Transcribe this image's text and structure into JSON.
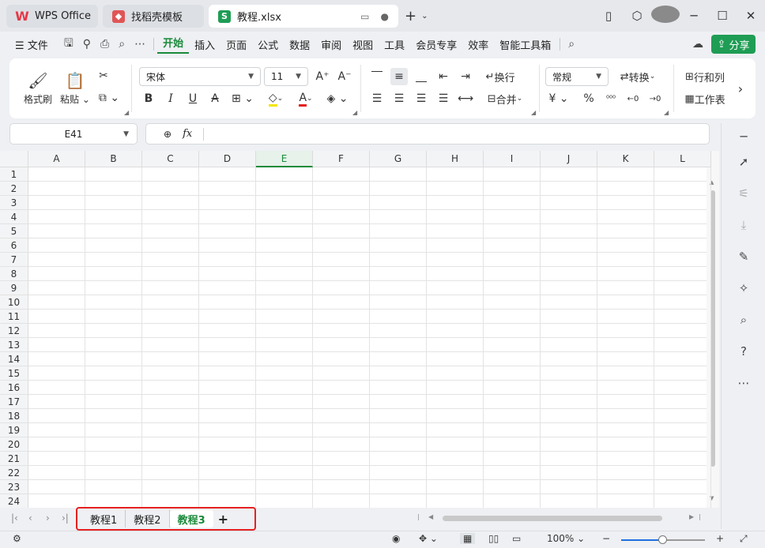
{
  "tabs": {
    "wps": "WPS Office",
    "template": "找稻壳模板",
    "doc": "教程.xlsx",
    "doc_icon_letter": "S"
  },
  "menu": {
    "file": "文件",
    "items": [
      "开始",
      "插入",
      "页面",
      "公式",
      "数据",
      "审阅",
      "视图",
      "工具",
      "会员专享",
      "效率",
      "智能工具箱"
    ],
    "active_index": 0,
    "share": "分享"
  },
  "ribbon": {
    "format_painter": "格式刷",
    "paste": "粘贴",
    "font_name": "宋体",
    "font_size": "11",
    "wrap": "换行",
    "merge": "合并",
    "number_format": "常规",
    "convert": "转换",
    "row_col": "行和列",
    "worksheet": "工作表"
  },
  "formula_bar": {
    "cell_ref": "E41",
    "fx": "fx",
    "content": ""
  },
  "grid": {
    "columns": [
      "A",
      "B",
      "C",
      "D",
      "E",
      "F",
      "G",
      "H",
      "I",
      "J",
      "K",
      "L"
    ],
    "selected_column": "E",
    "rows": [
      "1",
      "2",
      "3",
      "4",
      "5",
      "6",
      "7",
      "8",
      "9",
      "10",
      "11",
      "12",
      "13",
      "14",
      "15",
      "16",
      "17",
      "18",
      "19",
      "20",
      "21",
      "22",
      "23",
      "24"
    ]
  },
  "sheet_tabs": {
    "items": [
      "教程1",
      "教程2",
      "教程3"
    ],
    "active_index": 2,
    "add": "+"
  },
  "status": {
    "zoom": "100%",
    "zoom_fraction": 0.5
  },
  "colors": {
    "accent": "#1a8a3a",
    "highlight_box": "#e52020"
  }
}
